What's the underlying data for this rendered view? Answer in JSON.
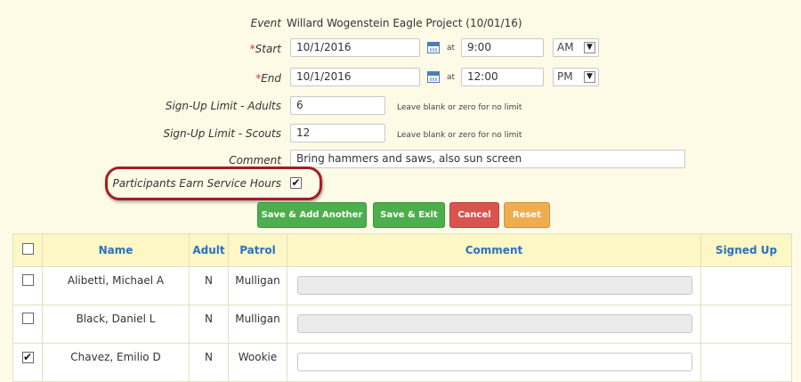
{
  "form": {
    "event_label": "Event",
    "event_value": "Willard Wogenstein Eagle Project (10/01/16)",
    "required_mark": "*",
    "start_label": "Start",
    "start_date": "10/1/2016",
    "at_label": "at",
    "start_time": "9:00",
    "start_ampm": "AM",
    "end_label": "End",
    "end_date": "10/1/2016",
    "end_time": "12:00",
    "end_ampm": "PM",
    "limit_adults_label": "Sign-Up Limit - Adults",
    "limit_adults_value": "6",
    "limit_scouts_label": "Sign-Up Limit - Scouts",
    "limit_scouts_value": "12",
    "limit_hint": "Leave blank or zero for no limit",
    "comment_label": "Comment",
    "comment_value": "Bring hammers and saws, also sun screen",
    "service_hours_label": "Participants Earn Service Hours",
    "service_hours_checked": true
  },
  "buttons": {
    "save_add": "Save & Add Another",
    "save_exit": "Save & Exit",
    "cancel": "Cancel",
    "reset": "Reset"
  },
  "colors": {
    "save": "#4cae4c",
    "cancel": "#d9534f",
    "reset": "#f0ad4e",
    "highlight": "#a31e22",
    "header_text": "#2a72c2"
  },
  "table": {
    "headers": [
      "",
      "Name",
      "Adult",
      "Patrol",
      "Comment",
      "Signed Up"
    ],
    "rows": [
      {
        "checked": false,
        "name": "Alibetti, Michael A",
        "adult": "N",
        "patrol": "Mulligan",
        "comment": "",
        "comment_editable": false,
        "signed_up": ""
      },
      {
        "checked": false,
        "name": "Black, Daniel L",
        "adult": "N",
        "patrol": "Mulligan",
        "comment": "",
        "comment_editable": false,
        "signed_up": ""
      },
      {
        "checked": true,
        "name": "Chavez, Emilio D",
        "adult": "N",
        "patrol": "Wookie",
        "comment": "",
        "comment_editable": true,
        "signed_up": ""
      }
    ]
  }
}
